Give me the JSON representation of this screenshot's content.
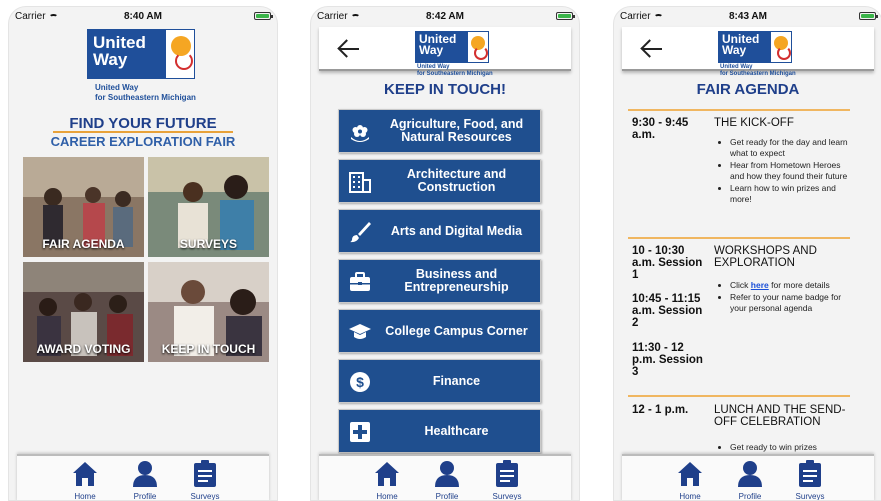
{
  "status": {
    "carrier": "Carrier",
    "times": [
      "8:40 AM",
      "8:42 AM",
      "8:43 AM"
    ]
  },
  "logo": {
    "line1": "United",
    "line2": "Way",
    "sub1": "United Way",
    "sub2": "for Southeastern Michigan"
  },
  "screen1": {
    "title": "FIND YOUR FUTURE",
    "subtitle": "CAREER EXPLORATION FAIR",
    "tiles": [
      "FAIR AGENDA",
      "SURVEYS",
      "AWARD VOTING",
      "KEEP IN TOUCH"
    ]
  },
  "screen2": {
    "title": "KEEP IN TOUCH!",
    "buttons": [
      {
        "label": "Agriculture, Food, and Natural Resources",
        "icon": "flower-icon"
      },
      {
        "label": "Architecture and Construction",
        "icon": "building-icon"
      },
      {
        "label": "Arts and Digital Media",
        "icon": "brush-icon"
      },
      {
        "label": "Business and Entrepreneurship",
        "icon": "briefcase-icon"
      },
      {
        "label": "College Campus Corner",
        "icon": "graduation-cap-icon"
      },
      {
        "label": "Finance",
        "icon": "dollar-icon"
      },
      {
        "label": "Healthcare",
        "icon": "medical-cross-icon"
      }
    ]
  },
  "screen3": {
    "title": "FAIR AGENDA",
    "items": [
      {
        "time": "9:30 - 9:45 a.m.",
        "event": "THE KICK-OFF",
        "bullets": [
          "Get ready for the day and learn what to expect",
          "Hear from Hometown Heroes and how they found their future",
          "Learn how to win prizes and more!"
        ]
      },
      {
        "time": "10 - 10:30 a.m. Session 1",
        "time2": "10:45 - 11:15 a.m. Session 2",
        "time3": "11:30 - 12 p.m. Session 3",
        "event": "WORKSHOPS AND EXPLORATION",
        "bullet1_pre": "Click ",
        "bullet1_link": "here",
        "bullet1_post": " for more details",
        "bullet2": "Refer to your name badge for your personal agenda"
      },
      {
        "time": "12 - 1 p.m.",
        "event": "LUNCH AND THE SEND-OFF CELEBRATION",
        "bullets": [
          "Get ready to win prizes"
        ]
      }
    ]
  },
  "tabs": [
    "Home",
    "Profile",
    "Surveys"
  ],
  "colors": {
    "brand": "#1f4f8f",
    "accent": "#e8a23a",
    "title": "#1f3f8a"
  }
}
